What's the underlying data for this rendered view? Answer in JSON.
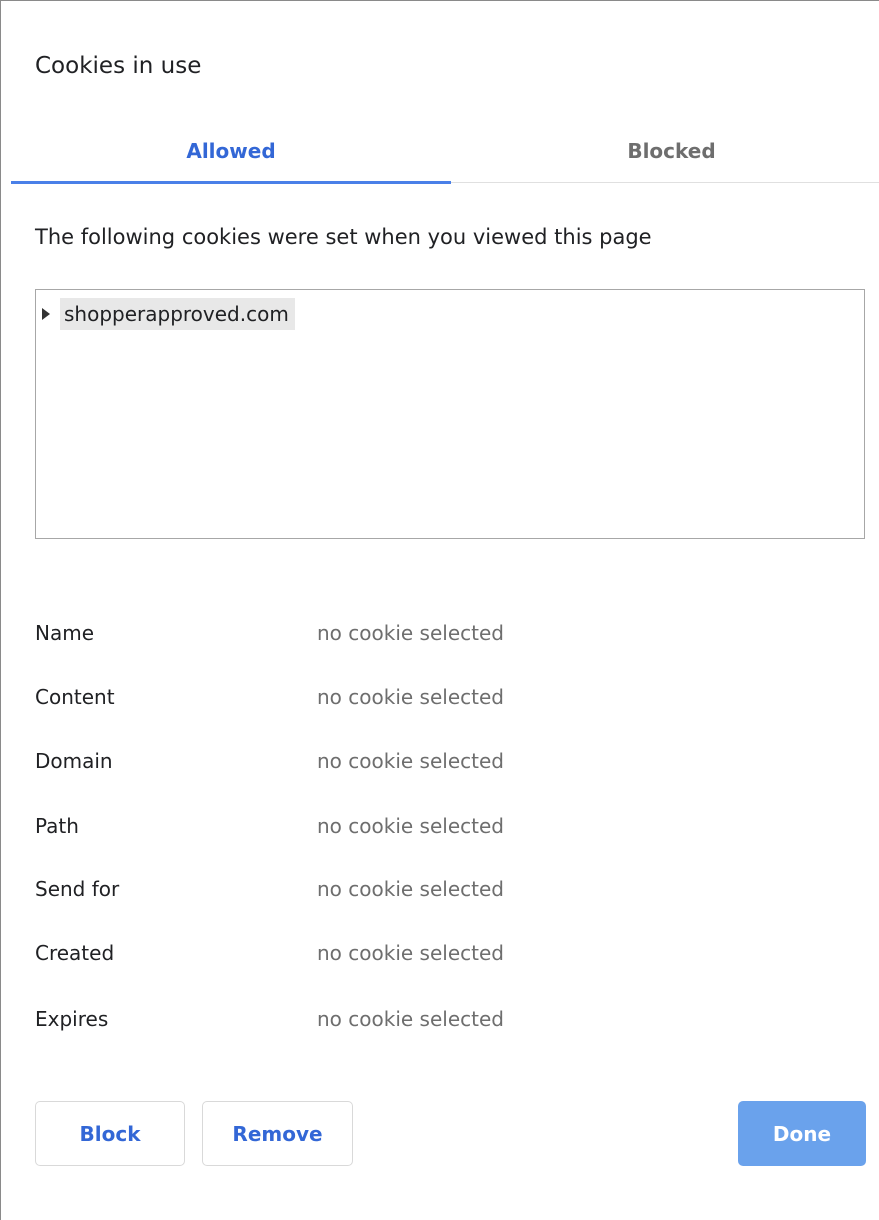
{
  "dialog": {
    "title": "Cookies in use"
  },
  "tabs": [
    {
      "label": "Allowed",
      "selected": true
    },
    {
      "label": "Blocked",
      "selected": false
    }
  ],
  "description": "The following cookies were set when you viewed this page",
  "tree": {
    "items": [
      {
        "label": "shopperapproved.com",
        "expanded": false
      }
    ]
  },
  "details": [
    {
      "label": "Name",
      "value": "no cookie selected"
    },
    {
      "label": "Content",
      "value": "no cookie selected"
    },
    {
      "label": "Domain",
      "value": "no cookie selected"
    },
    {
      "label": "Path",
      "value": "no cookie selected"
    },
    {
      "label": "Send for",
      "value": "no cookie selected"
    },
    {
      "label": "Created",
      "value": "no cookie selected"
    },
    {
      "label": "Expires",
      "value": "no cookie selected"
    }
  ],
  "buttons": {
    "block": "Block",
    "remove": "Remove",
    "done": "Done"
  },
  "colors": {
    "accent": "#3367d6",
    "tab_indicator": "#4a80e8",
    "primary_button": "#6aa2ec",
    "muted_text": "#6e6e6e"
  }
}
